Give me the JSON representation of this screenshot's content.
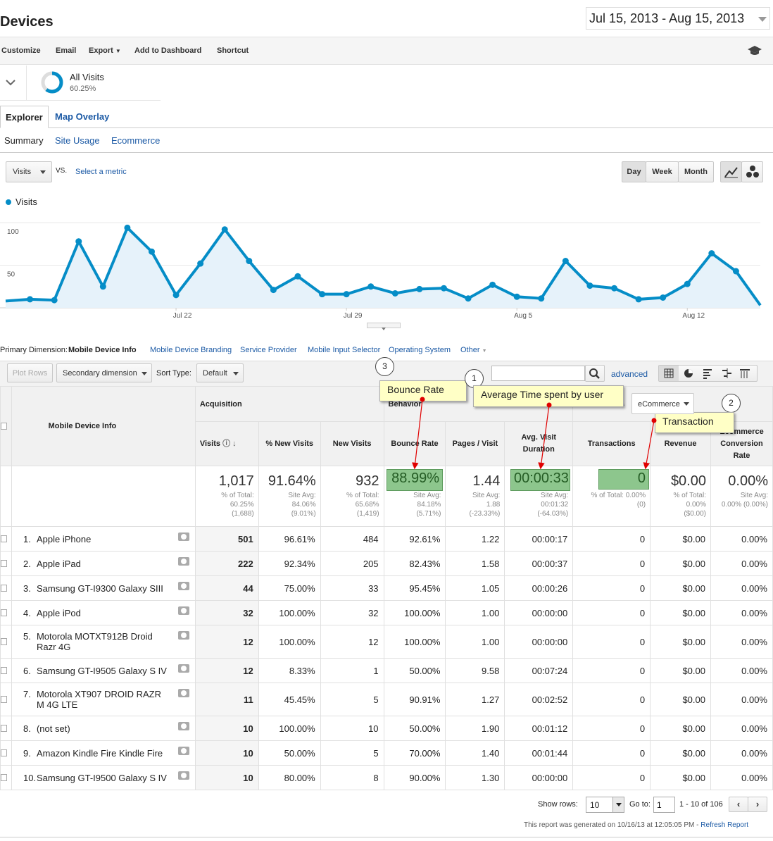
{
  "page": {
    "title": "Devices",
    "date_range": "Jul 15, 2013 - Aug 15, 2013"
  },
  "toolbar": {
    "customize": "Customize",
    "email": "Email",
    "export": "Export",
    "add_to_dashboard": "Add to Dashboard",
    "shortcut": "Shortcut"
  },
  "segment": {
    "name": "All Visits",
    "percent": "60.25%",
    "fraction": 0.6025
  },
  "tabs": {
    "explorer": "Explorer",
    "map_overlay": "Map Overlay"
  },
  "subtabs": {
    "summary": "Summary",
    "site_usage": "Site Usage",
    "ecommerce": "Ecommerce"
  },
  "metric_controls": {
    "metric": "Visits",
    "vs": "VS.",
    "select_metric": "Select a metric",
    "day": "Day",
    "week": "Week",
    "month": "Month"
  },
  "chart_data": {
    "type": "line",
    "series": [
      {
        "name": "Visits",
        "color": "#058dc7",
        "values": [
          8,
          10,
          9,
          78,
          25,
          94,
          66,
          15,
          52,
          92,
          55,
          21,
          37,
          16,
          16,
          25,
          17,
          22,
          23,
          11,
          27,
          13,
          11,
          55,
          26,
          23,
          10,
          12,
          28,
          64,
          43,
          3
        ]
      }
    ],
    "x_tick_labels": [
      "Jul 22",
      "Jul 29",
      "Aug 5",
      "Aug 12"
    ],
    "y_tick_labels": [
      "100",
      "50"
    ],
    "ylim": [
      0,
      115
    ],
    "legend": "Visits"
  },
  "primary_dimension": {
    "label": "Primary Dimension:",
    "active": "Mobile Device Info",
    "options": [
      "Mobile Device Branding",
      "Service Provider",
      "Mobile Input Selector",
      "Operating System",
      "Other"
    ]
  },
  "table_controls": {
    "plot_rows": "Plot Rows",
    "secondary": "Secondary dimension",
    "sort_type_label": "Sort Type:",
    "sort_type": "Default",
    "advanced": "advanced",
    "conversions_select": "eCommerce"
  },
  "table": {
    "dimension_header": "Mobile Device Info",
    "groups": {
      "acquisition": "Acquisition",
      "behavior": "Behavior",
      "conversions": "Conversions"
    },
    "columns": [
      "Visits",
      "% New Visits",
      "New Visits",
      "Bounce Rate",
      "Pages / Visit",
      "Avg. Visit Duration",
      "Transactions",
      "Revenue",
      "Ecommerce Conversion Rate"
    ],
    "totals": [
      {
        "value": "1,017",
        "sub": "% of Total:",
        "sub2": "60.25%",
        "sub3": "(1,688)"
      },
      {
        "value": "91.64%",
        "sub": "Site Avg:",
        "sub2": "84.06%",
        "sub3": "(9.01%)"
      },
      {
        "value": "932",
        "sub": "% of Total:",
        "sub2": "65.68%",
        "sub3": "(1,419)"
      },
      {
        "value": "88.99%",
        "sub": "Site Avg:",
        "sub2": "84.18%",
        "sub3": "(5.71%)"
      },
      {
        "value": "1.44",
        "sub": "Site Avg:",
        "sub2": "1.88",
        "sub3": "(-23.33%)"
      },
      {
        "value": "00:00:33",
        "sub": "Site Avg:",
        "sub2": "00:01:32",
        "sub3": "(-64.03%)"
      },
      {
        "value": "0",
        "sub": "% of Total: 0.00%",
        "sub2": "(0)",
        "sub3": ""
      },
      {
        "value": "$0.00",
        "sub": "% of Total:",
        "sub2": "0.00%",
        "sub3": "($0.00)"
      },
      {
        "value": "0.00%",
        "sub": "Site Avg:",
        "sub2": "0.00% (0.00%)",
        "sub3": ""
      }
    ],
    "rows": [
      {
        "n": "1.",
        "name": "Apple iPhone",
        "v": [
          "501",
          "96.61%",
          "484",
          "92.61%",
          "1.22",
          "00:00:17",
          "0",
          "$0.00",
          "0.00%"
        ]
      },
      {
        "n": "2.",
        "name": "Apple iPad",
        "v": [
          "222",
          "92.34%",
          "205",
          "82.43%",
          "1.58",
          "00:00:37",
          "0",
          "$0.00",
          "0.00%"
        ]
      },
      {
        "n": "3.",
        "name": "Samsung GT-I9300 Galaxy SIII",
        "v": [
          "44",
          "75.00%",
          "33",
          "95.45%",
          "1.05",
          "00:00:26",
          "0",
          "$0.00",
          "0.00%"
        ]
      },
      {
        "n": "4.",
        "name": "Apple iPod",
        "v": [
          "32",
          "100.00%",
          "32",
          "100.00%",
          "1.00",
          "00:00:00",
          "0",
          "$0.00",
          "0.00%"
        ]
      },
      {
        "n": "5.",
        "name": "Motorola MOTXT912B Droid Razr 4G",
        "v": [
          "12",
          "100.00%",
          "12",
          "100.00%",
          "1.00",
          "00:00:00",
          "0",
          "$0.00",
          "0.00%"
        ]
      },
      {
        "n": "6.",
        "name": "Samsung GT-I9505 Galaxy S IV",
        "v": [
          "12",
          "8.33%",
          "1",
          "50.00%",
          "9.58",
          "00:07:24",
          "0",
          "$0.00",
          "0.00%"
        ]
      },
      {
        "n": "7.",
        "name": "Motorola XT907 DROID RAZR M 4G LTE",
        "v": [
          "11",
          "45.45%",
          "5",
          "90.91%",
          "1.27",
          "00:02:52",
          "0",
          "$0.00",
          "0.00%"
        ]
      },
      {
        "n": "8.",
        "name": "(not set)",
        "v": [
          "10",
          "100.00%",
          "10",
          "50.00%",
          "1.90",
          "00:01:12",
          "0",
          "$0.00",
          "0.00%"
        ]
      },
      {
        "n": "9.",
        "name": "Amazon Kindle Fire Kindle Fire",
        "v": [
          "10",
          "50.00%",
          "5",
          "70.00%",
          "1.40",
          "00:01:44",
          "0",
          "$0.00",
          "0.00%"
        ]
      },
      {
        "n": "10.",
        "name": "Samsung GT-I9500 Galaxy S IV",
        "v": [
          "10",
          "80.00%",
          "8",
          "90.00%",
          "1.30",
          "00:00:00",
          "0",
          "$0.00",
          "0.00%"
        ]
      }
    ]
  },
  "callouts": {
    "bounce": "Bounce Rate",
    "avg_time": "Average Time spent by user",
    "transaction": "Transaction",
    "n1": "1",
    "n2": "2",
    "n3": "3"
  },
  "pagination": {
    "show_rows_label": "Show rows:",
    "show_rows": "10",
    "goto_label": "Go to:",
    "goto": "1",
    "range": "1 - 10 of 106"
  },
  "footer": {
    "generated": "This report was generated on 10/16/13 at 12:05:05 PM -",
    "refresh": "Refresh Report"
  }
}
